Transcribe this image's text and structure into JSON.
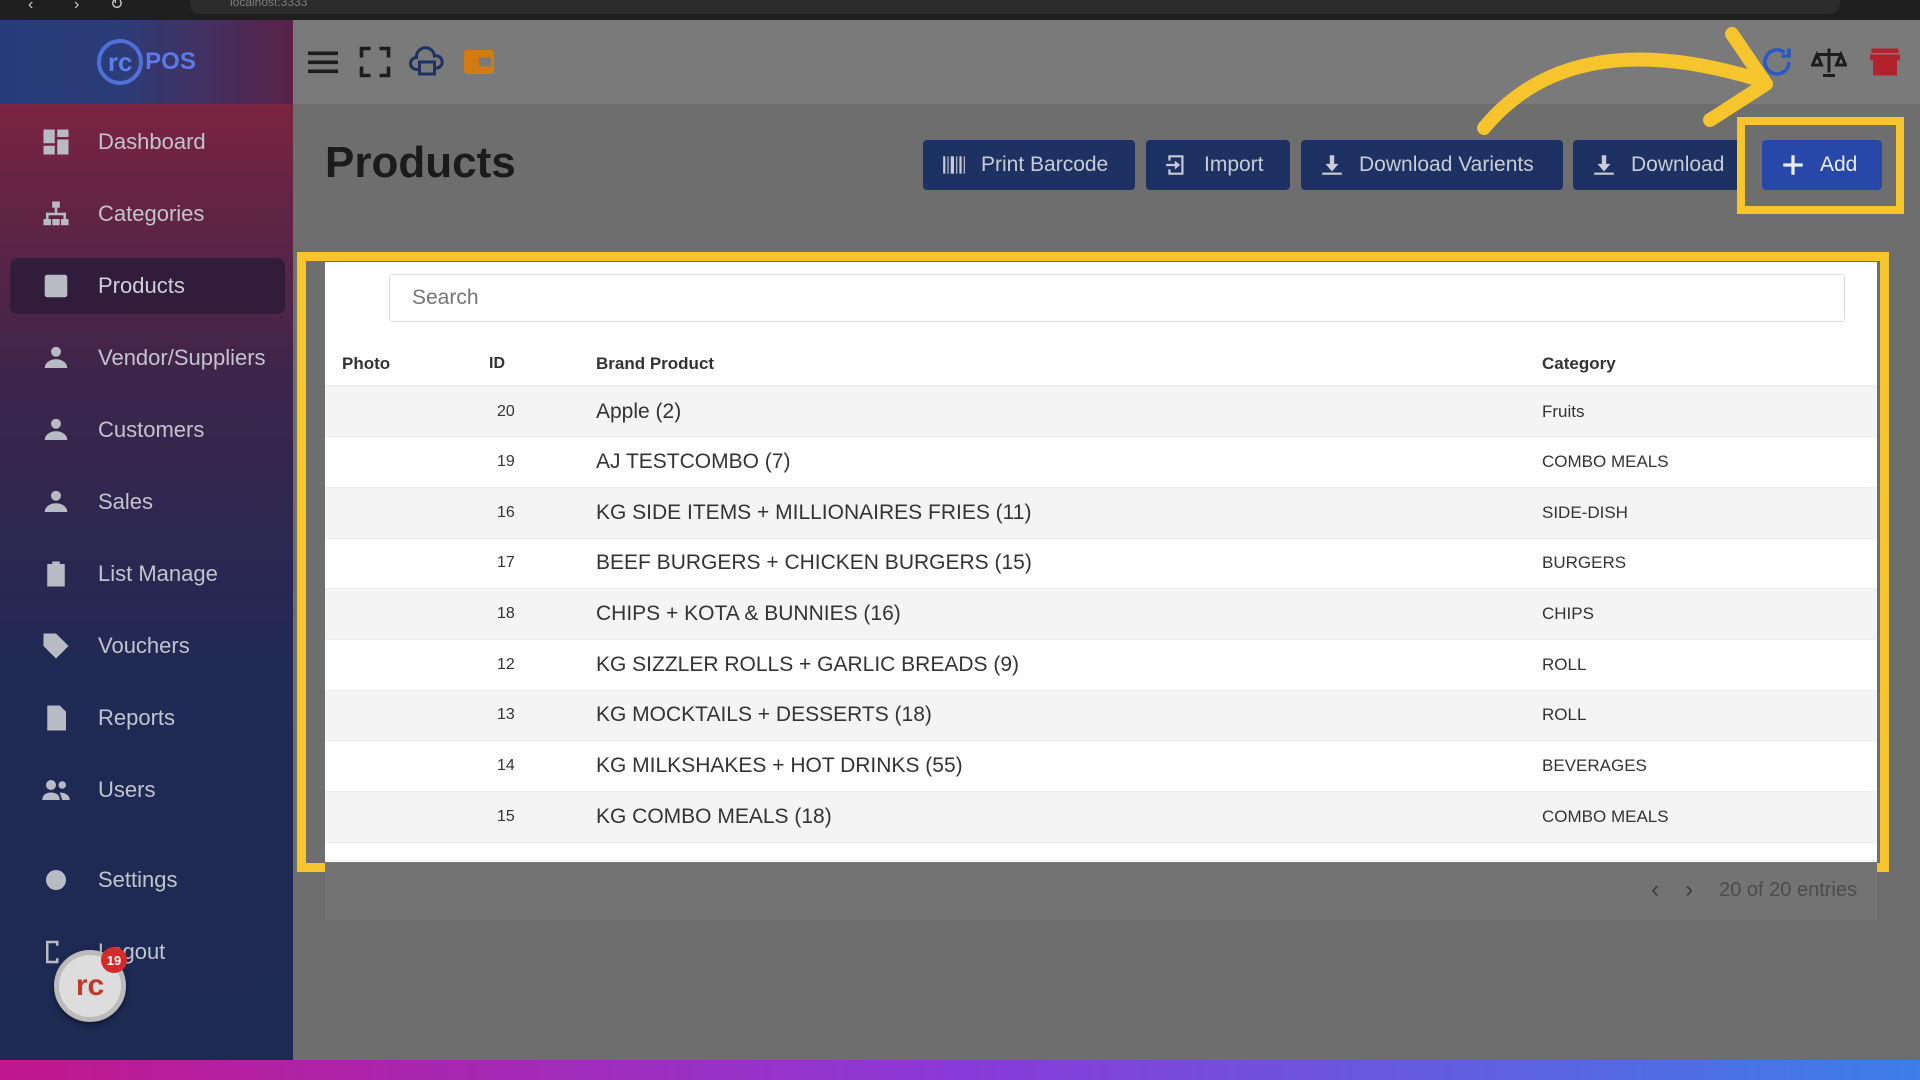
{
  "browser": {
    "url": "localhost:3333"
  },
  "sidebar": {
    "logo": {
      "mark": "rc",
      "text": "POS"
    },
    "items": [
      {
        "label": "Dashboard",
        "icon": "dashboard-icon"
      },
      {
        "label": "Categories",
        "icon": "sitemap-icon"
      },
      {
        "label": "Products",
        "icon": "box-icon",
        "active": true
      },
      {
        "label": "Vendor/Suppliers",
        "icon": "person-icon"
      },
      {
        "label": "Customers",
        "icon": "person-icon"
      },
      {
        "label": "Sales",
        "icon": "person-icon"
      },
      {
        "label": "List Manage",
        "icon": "clipboard-icon"
      },
      {
        "label": "Vouchers",
        "icon": "tag-icon"
      },
      {
        "label": "Reports",
        "icon": "document-icon"
      },
      {
        "label": "Users",
        "icon": "users-icon"
      },
      {
        "label": "Settings",
        "icon": "gear-icon"
      },
      {
        "label": "Logout",
        "icon": "logout-icon"
      }
    ],
    "notification_count": "19",
    "avatar_mark": "rc"
  },
  "topbar": {
    "icons": [
      "menu-icon",
      "fullscreen-icon",
      "cloud-print-icon",
      "wallet-icon",
      "sync-icon",
      "scale-icon",
      "store-icon"
    ]
  },
  "page": {
    "title": "Products",
    "buttons": {
      "print_barcode": "Print Barcode",
      "import": "Import",
      "download_variants": "Download Varients",
      "download": "Download",
      "add": "Add"
    },
    "search": {
      "placeholder": "Search"
    },
    "table": {
      "headers": {
        "photo": "Photo",
        "id": "ID",
        "name": "Brand Product",
        "category": "Category"
      },
      "rows": [
        {
          "id": "20",
          "name": "Apple (2)",
          "category": "Fruits"
        },
        {
          "id": "19",
          "name": "AJ TESTCOMBO (7)",
          "category": "COMBO MEALS"
        },
        {
          "id": "16",
          "name": "KG SIDE ITEMS + MILLIONAIRES FRIES (11)",
          "category": "SIDE-DISH"
        },
        {
          "id": "17",
          "name": "BEEF BURGERS + CHICKEN BURGERS (15)",
          "category": "BURGERS"
        },
        {
          "id": "18",
          "name": "CHIPS + KOTA & BUNNIES (16)",
          "category": "CHIPS"
        },
        {
          "id": "12",
          "name": "KG SIZZLER ROLLS + GARLIC BREADS (9)",
          "category": "ROLL"
        },
        {
          "id": "13",
          "name": "KG MOCKTAILS + DESSERTS (18)",
          "category": "ROLL"
        },
        {
          "id": "14",
          "name": "KG MILKSHAKES + HOT DRINKS (55)",
          "category": "BEVERAGES"
        },
        {
          "id": "15",
          "name": "KG COMBO MEALS (18)",
          "category": "COMBO MEALS"
        }
      ]
    },
    "pagination": {
      "summary": "20 of 20 entries"
    }
  },
  "colors": {
    "highlight": "#f6c42c",
    "button": "#1d3263",
    "add_button": "#2748a8"
  }
}
